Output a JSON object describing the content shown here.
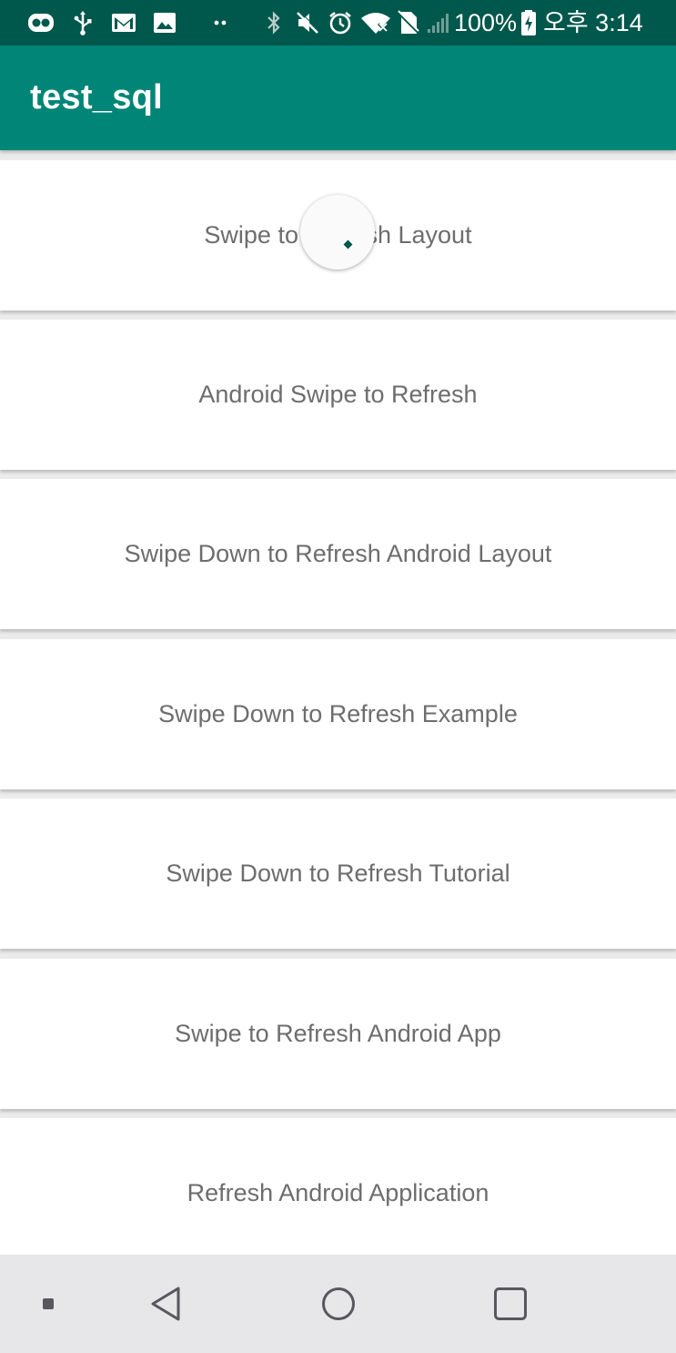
{
  "status_bar": {
    "battery": "100%",
    "time": "오후 3:14",
    "background": "#00574b",
    "icons": [
      "cardboard-icon",
      "usb-icon",
      "gmail-icon",
      "gallery-icon",
      "more-dots-icon",
      "bluetooth-icon",
      "mute-icon",
      "alarm-icon",
      "wifi-icon",
      "no-sim-icon",
      "signal-icon",
      "battery-icon"
    ]
  },
  "app_bar": {
    "title": "test_sql",
    "background": "#008577"
  },
  "list": {
    "items": [
      {
        "label": "Swipe to Refresh Layout"
      },
      {
        "label": "Android Swipe to Refresh"
      },
      {
        "label": "Swipe Down to Refresh Android Layout"
      },
      {
        "label": "Swipe Down to Refresh Example"
      },
      {
        "label": "Swipe Down to Refresh Tutorial"
      },
      {
        "label": "Swipe to Refresh Android App"
      },
      {
        "label": "Refresh Android Application"
      }
    ]
  },
  "refresh_indicator": {
    "state": "refreshing",
    "accent": "#00574b"
  },
  "nav_bar": {
    "buttons": [
      "recents-dot",
      "back-icon",
      "home-icon",
      "overview-icon"
    ],
    "background": "#e7e7ea"
  }
}
